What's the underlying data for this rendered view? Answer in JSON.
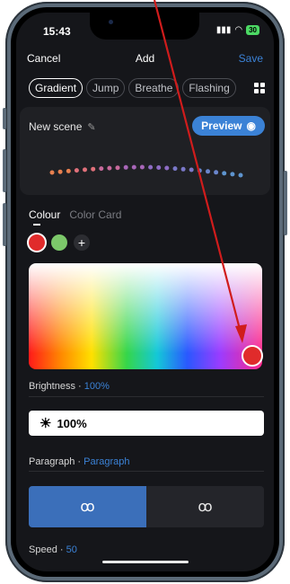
{
  "status": {
    "time": "15:43",
    "battery": "30"
  },
  "nav": {
    "cancel": "Cancel",
    "title": "Add",
    "save": "Save"
  },
  "mode_tabs": [
    {
      "label": "Gradient",
      "active": true
    },
    {
      "label": "Jump",
      "active": false
    },
    {
      "label": "Breathe",
      "active": false
    },
    {
      "label": "Flashing",
      "active": false
    }
  ],
  "scene": {
    "name": "New scene",
    "preview_label": "Preview"
  },
  "colour": {
    "tab_active": "Colour",
    "tab_inactive": "Color Card",
    "swatches": [
      "#e02b2b",
      "#7cc86a"
    ],
    "add": "+"
  },
  "brightness": {
    "label": "Brightness",
    "value": "100%"
  },
  "paragraph": {
    "label": "Paragraph",
    "value": "Paragraph"
  },
  "speed": {
    "label": "Speed",
    "value": "50"
  },
  "colors": {
    "accent": "#3b82d6",
    "annotation": "#d01c1c"
  }
}
